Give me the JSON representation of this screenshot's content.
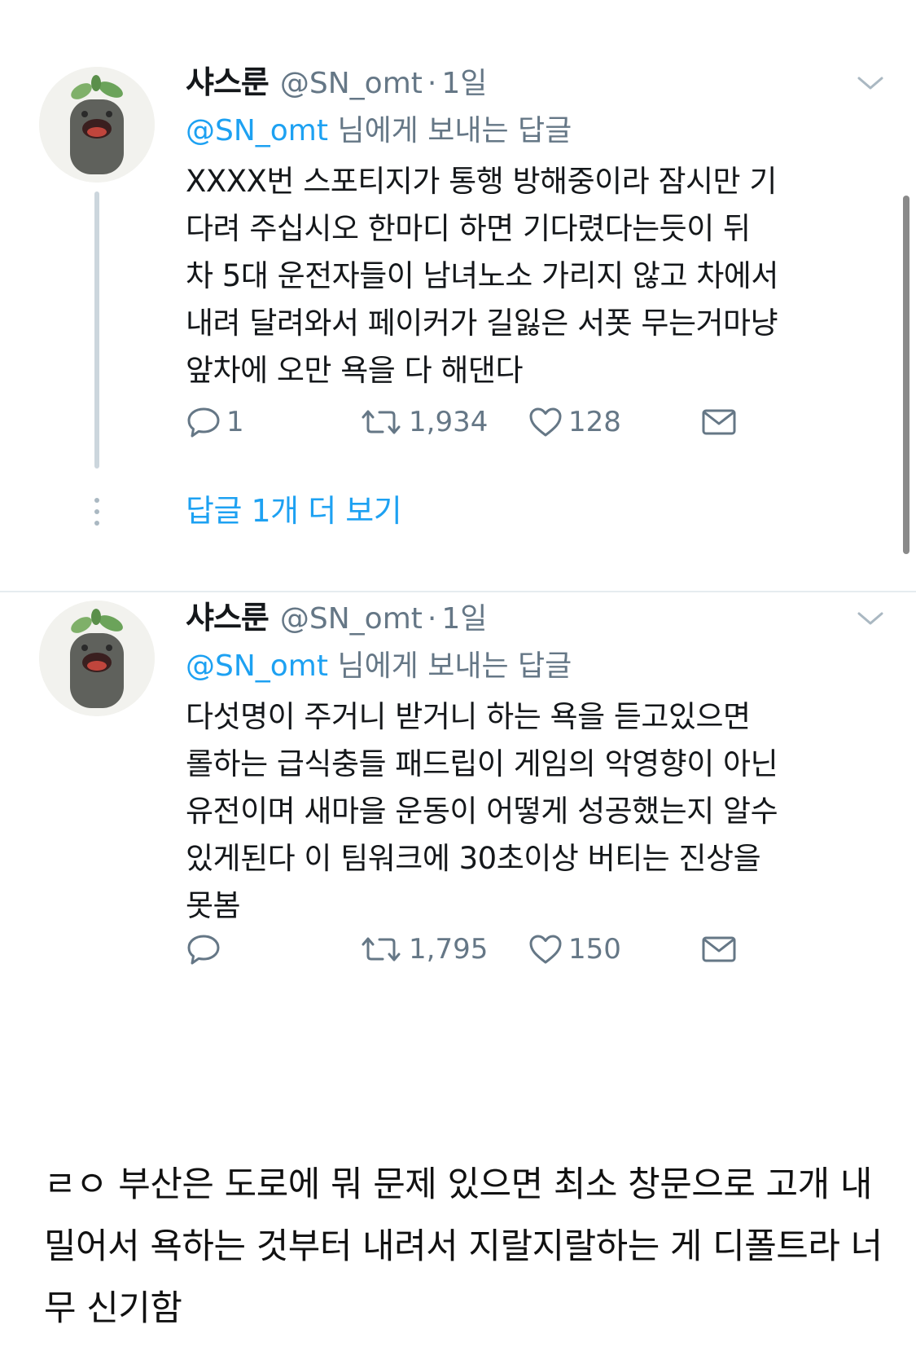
{
  "tweets": [
    {
      "author": {
        "name": "샤스룬",
        "handle": "@SN_omt",
        "time": "1일"
      },
      "reply_prefix": "@SN_omt",
      "reply_suffix": " 님에게 보내는 답글",
      "text": "XXXX번 스포티지가 통행 방해중이라 잠시만 기\n다려 주십시오 한마디 하면 기다렸다는듯이 뒤\n차 5대 운전자들이 남녀노소 가리지 않고 차에서\n내려 달려와서 페이커가 길잃은 서폿 무는거마냥\n앞차에 오만 욕을 다 해댄다",
      "replies": "1",
      "retweets": "1,934",
      "likes": "128",
      "more_replies_label": "답글 1개 더 보기"
    },
    {
      "author": {
        "name": "샤스룬",
        "handle": "@SN_omt",
        "time": "1일"
      },
      "reply_prefix": "@SN_omt",
      "reply_suffix": " 님에게 보내는 답글",
      "text": "다섯명이 주거니 받거니 하는 욕을 듣고있으면\n롤하는 급식충들 패드립이 게임의 악영향이 아닌\n유전이며 새마을 운동이 어떻게 성공했는지 알수\n있게된다 이 팀워크에 30초이상 버티는 진상을\n못봄",
      "replies": "",
      "retweets": "1,795",
      "likes": "150"
    }
  ],
  "caption": "ㄹㅇ 부산은 도로에 뭐 문제 있으면 최소 창문으로 고개 내밀어서 욕하는 것부터 내려서 지랄지랄하는 게 디폴트라 너무 신기함",
  "icons": {
    "reply": "speech-bubble-icon",
    "retweet": "retweet-icon",
    "like": "heart-icon",
    "dm": "envelope-icon",
    "caret": "chevron-down-icon"
  },
  "colors": {
    "link_blue": "#1da1f2",
    "muted_gray": "#657786",
    "text": "#14171a"
  }
}
